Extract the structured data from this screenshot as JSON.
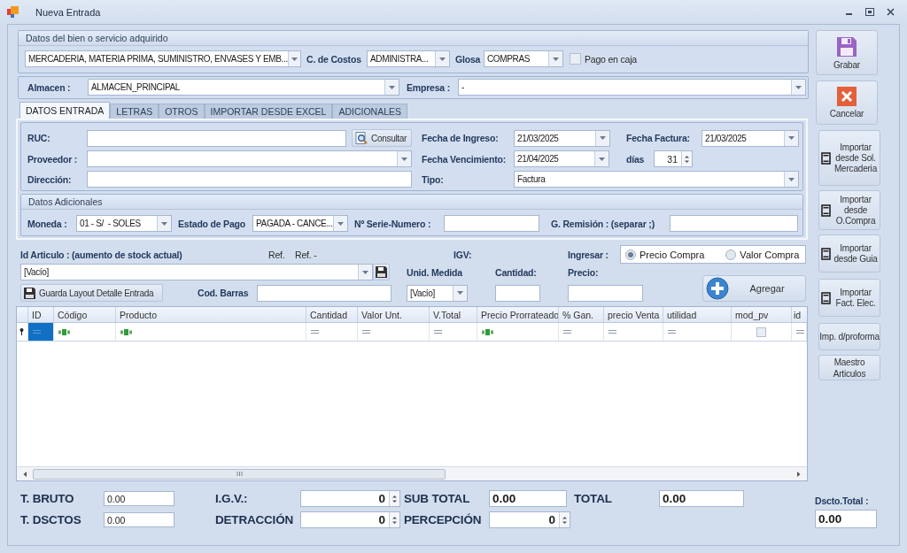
{
  "window": {
    "title": "Nueva Entrada"
  },
  "datos_bien": {
    "title": "Datos del bien o servicio adquirido",
    "tipo": "MERCADERIA, MATERIA PRIMA, SUMINISTRO, ENVASES Y EMB...",
    "costos_label": "C. de Costos",
    "costos": "ADMINISTRA...",
    "glosa_label": "Glosa",
    "glosa": "COMPRAS",
    "pago_en_caja": {
      "label": "Pago en caja",
      "checked": false
    }
  },
  "almacen": {
    "label": "Almacen :",
    "value": "ALMACEN_PRINCIPAL"
  },
  "empresa": {
    "label": "Empresa :",
    "value": "-"
  },
  "tabs": [
    {
      "label": "DATOS ENTRADA",
      "selected": true
    },
    {
      "label": "LETRAS",
      "selected": false
    },
    {
      "label": "OTROS",
      "selected": false
    },
    {
      "label": "IMPORTAR DESDE EXCEL",
      "selected": false
    },
    {
      "label": "ADICIONALES",
      "selected": false
    }
  ],
  "datos_entrada": {
    "ruc_label": "RUC:",
    "consultar": "Consultar",
    "proveedor_label": "Proveedor :",
    "direccion_label": "Dirección:",
    "fecha_ingreso_label": "Fecha de Ingreso:",
    "fecha_ingreso": "21/03/2025",
    "fecha_factura_label": "Fecha Factura:",
    "fecha_factura": "21/03/2025",
    "fecha_vencimiento_label": "Fecha Vencimiento:",
    "fecha_vencimiento": "21/04/2025",
    "dias_label": "días",
    "dias": "31",
    "tipo_label": "Tipo:",
    "tipo": "Factura"
  },
  "datos_adicionales": {
    "title": "Datos Adicionales",
    "moneda_label": "Moneda :",
    "moneda": "01 - S/  - SOLES",
    "estado_label": "Estado de Pago",
    "estado": "PAGADA - CANCE...",
    "serie_label": "Nº Serie-Numero :",
    "remision_label": "G. Remisión : (separar ;)"
  },
  "item_entry": {
    "articulo_label": "Id Articulo : (aumento de stock actual)",
    "ref_1": "Ref.",
    "ref_2": "Ref. -",
    "igv_label": "IGV:",
    "ingresar": {
      "label": "Ingresar :",
      "options": [
        {
          "label": "Precio Compra",
          "selected": true
        },
        {
          "label": "Valor Compra",
          "selected": false
        }
      ]
    },
    "articulo": "[Vacío]",
    "unidad_label": "Unid. Medida",
    "cantidad_label": "Cantidad:",
    "precio_label": "Precio:",
    "guarda_layout": "Guarda Layout Detalle Entrada",
    "cod_barras_label": "Cod. Barras",
    "unidad": "[Vacío]",
    "agregar": "Agregar"
  },
  "grid": {
    "columns": [
      "ID",
      "Código",
      "Producto",
      "Cantidad",
      "Valor Unt.",
      "V.Total",
      "Precio Prorrateado",
      "% Gan.",
      "precio Venta",
      "utilidad",
      "mod_pv",
      "id"
    ],
    "row": {
      "cells": [
        {
          "kind": "number",
          "selected": true
        },
        {
          "kind": "text",
          "selected": false
        },
        {
          "kind": "text",
          "selected": false
        },
        {
          "kind": "number",
          "selected": false
        },
        {
          "kind": "number",
          "selected": false
        },
        {
          "kind": "number",
          "selected": false
        },
        {
          "kind": "text",
          "selected": false
        },
        {
          "kind": "number",
          "selected": false
        },
        {
          "kind": "number",
          "selected": false
        },
        {
          "kind": "number",
          "selected": false
        },
        {
          "kind": "checkbox",
          "selected": false,
          "checked": false
        },
        {
          "kind": "number",
          "selected": false
        }
      ]
    }
  },
  "totals": {
    "bruto_label": "T. BRUTO",
    "bruto": "0.00",
    "dsctos_label": "T. DSCTOS",
    "dsctos": "0.00",
    "igv_label": "I.G.V.:",
    "igv": "0",
    "detraccion_label": "DETRACCIÓN",
    "detraccion": "0",
    "subtotal_label": "SUB TOTAL",
    "subtotal": "0.00",
    "percepcion_label": "PERCEPCIÓN",
    "percepcion": "0",
    "total_label": "TOTAL",
    "total": "0.00"
  },
  "side_buttons": [
    {
      "label": "Grabar",
      "kind": "save"
    },
    {
      "label": "Cancelar",
      "kind": "cancel"
    },
    {
      "label": "Importar desde Sol. Mercaderia",
      "kind": "import"
    },
    {
      "label": "Importar desde O.Compra",
      "kind": "import"
    },
    {
      "label": "Importar desde Guia",
      "kind": "import"
    },
    {
      "label": "Importar Fact. Elec.",
      "kind": "import"
    },
    {
      "label": "Imp. d/proforma",
      "kind": "plain"
    },
    {
      "label": "Maestro Articulos",
      "kind": "plain"
    }
  ],
  "dscto_total": {
    "label": "Dscto.Total :",
    "value": "0.00"
  }
}
